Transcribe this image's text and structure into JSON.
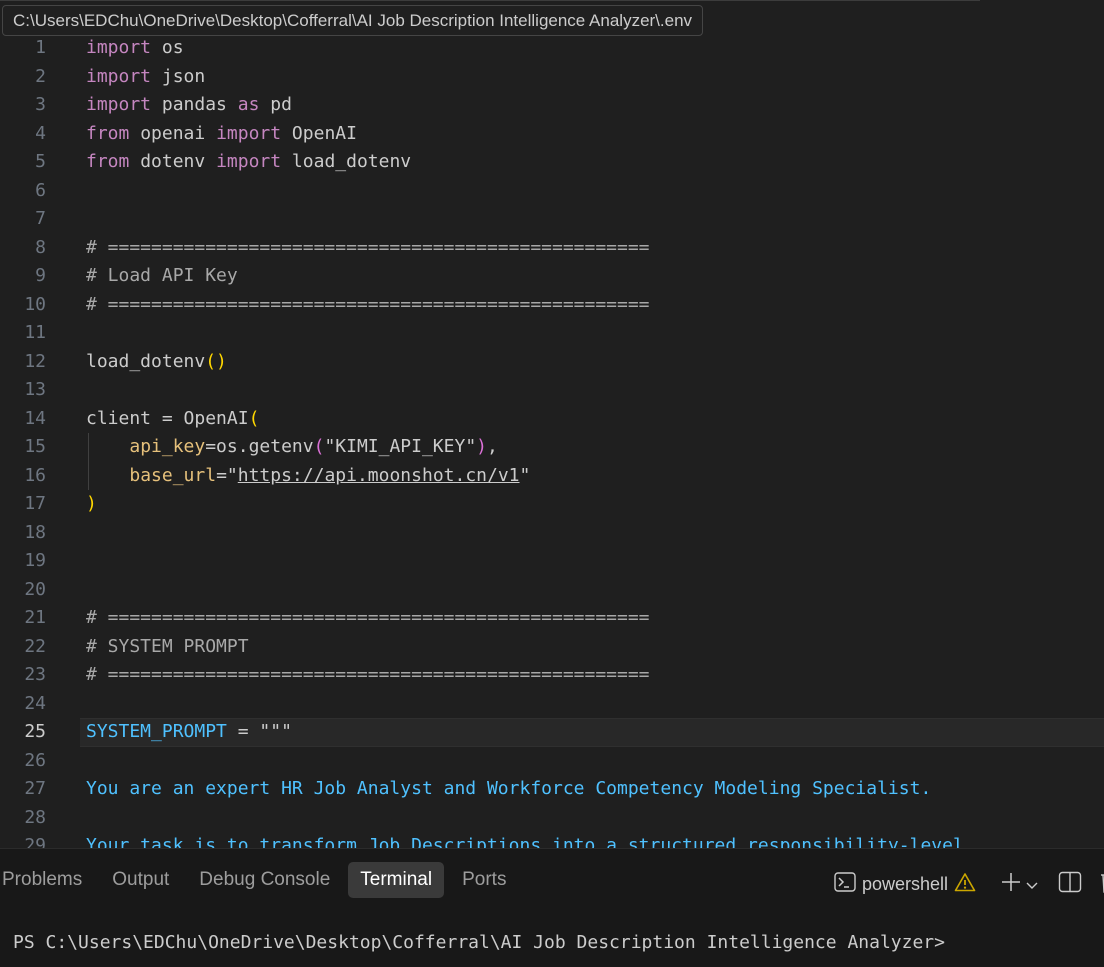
{
  "tooltip": {
    "path": "C:\\Users\\EDChu\\OneDrive\\Desktop\\Cofferral\\AI Job Description Intelligence Analyzer\\.env"
  },
  "editor": {
    "lines": [
      {
        "n": "1",
        "tokens": [
          {
            "t": "import",
            "c": "kw"
          },
          {
            "t": " os",
            "c": "pl"
          }
        ]
      },
      {
        "n": "2",
        "tokens": [
          {
            "t": "import",
            "c": "kw"
          },
          {
            "t": " json",
            "c": "pl"
          }
        ]
      },
      {
        "n": "3",
        "tokens": [
          {
            "t": "import",
            "c": "kw"
          },
          {
            "t": " pandas ",
            "c": "pl"
          },
          {
            "t": "as",
            "c": "kw"
          },
          {
            "t": " pd",
            "c": "pl"
          }
        ]
      },
      {
        "n": "4",
        "tokens": [
          {
            "t": "from",
            "c": "kw"
          },
          {
            "t": " openai ",
            "c": "pl"
          },
          {
            "t": "import",
            "c": "kw"
          },
          {
            "t": " OpenAI",
            "c": "pl"
          }
        ]
      },
      {
        "n": "5",
        "tokens": [
          {
            "t": "from",
            "c": "kw"
          },
          {
            "t": " dotenv ",
            "c": "pl"
          },
          {
            "t": "import",
            "c": "kw"
          },
          {
            "t": " load_dotenv",
            "c": "pl"
          }
        ]
      },
      {
        "n": "6",
        "tokens": []
      },
      {
        "n": "7",
        "tokens": []
      },
      {
        "n": "8",
        "tokens": [
          {
            "t": "# ==================================================",
            "c": "cmg"
          }
        ]
      },
      {
        "n": "9",
        "tokens": [
          {
            "t": "# Load API Key",
            "c": "cmg"
          }
        ]
      },
      {
        "n": "10",
        "tokens": [
          {
            "t": "# ==================================================",
            "c": "cmg"
          }
        ]
      },
      {
        "n": "11",
        "tokens": []
      },
      {
        "n": "12",
        "tokens": [
          {
            "t": "load_dotenv",
            "c": "fn"
          },
          {
            "t": "()",
            "c": "par"
          }
        ]
      },
      {
        "n": "13",
        "tokens": []
      },
      {
        "n": "14",
        "tokens": [
          {
            "t": "client = OpenAI",
            "c": "pl"
          },
          {
            "t": "(",
            "c": "par"
          }
        ]
      },
      {
        "n": "15",
        "guide": true,
        "tokens": [
          {
            "t": "    ",
            "c": "pl"
          },
          {
            "t": "api_key",
            "c": "attr"
          },
          {
            "t": "=os.getenv",
            "c": "pl"
          },
          {
            "t": "(",
            "c": "par2"
          },
          {
            "t": "\"KIMI_API_KEY\"",
            "c": "pl"
          },
          {
            "t": ")",
            "c": "par2"
          },
          {
            "t": ",",
            "c": "pl"
          }
        ]
      },
      {
        "n": "16",
        "guide": true,
        "tokens": [
          {
            "t": "    ",
            "c": "pl"
          },
          {
            "t": "base_url",
            "c": "attr"
          },
          {
            "t": "=\"",
            "c": "pl"
          },
          {
            "t": "https://api.moonshot.cn/v1",
            "c": "pl link"
          },
          {
            "t": "\"",
            "c": "pl"
          }
        ]
      },
      {
        "n": "17",
        "tokens": [
          {
            "t": ")",
            "c": "par"
          }
        ]
      },
      {
        "n": "18",
        "tokens": []
      },
      {
        "n": "19",
        "tokens": []
      },
      {
        "n": "20",
        "tokens": []
      },
      {
        "n": "21",
        "tokens": [
          {
            "t": "# ==================================================",
            "c": "cmg"
          }
        ]
      },
      {
        "n": "22",
        "tokens": [
          {
            "t": "# SYSTEM PROMPT",
            "c": "cmg"
          }
        ]
      },
      {
        "n": "23",
        "tokens": [
          {
            "t": "# ==================================================",
            "c": "cmg"
          }
        ]
      },
      {
        "n": "24",
        "tokens": []
      },
      {
        "n": "25",
        "current": true,
        "tokens": [
          {
            "t": "SYSTEM_PROMPT",
            "c": "var"
          },
          {
            "t": " = \"\"\"",
            "c": "pl"
          }
        ]
      },
      {
        "n": "26",
        "tokens": []
      },
      {
        "n": "27",
        "tokens": [
          {
            "t": "You are an expert HR Job Analyst and Workforce Competency Modeling Specialist.",
            "c": "doc"
          }
        ]
      },
      {
        "n": "28",
        "tokens": []
      },
      {
        "n": "29",
        "tokens": [
          {
            "t": "Your task is to transform Job Descriptions into a structured responsibility-level",
            "c": "doc"
          }
        ]
      }
    ]
  },
  "panel": {
    "tabs": [
      {
        "label": "Problems",
        "active": false
      },
      {
        "label": "Output",
        "active": false
      },
      {
        "label": "Debug Console",
        "active": false
      },
      {
        "label": "Terminal",
        "active": true
      },
      {
        "label": "Ports",
        "active": false
      }
    ],
    "shell_label": "powershell",
    "terminal_prompt": "PS C:\\Users\\EDChu\\OneDrive\\Desktop\\Cofferral\\AI Job Description Intelligence Analyzer>"
  }
}
